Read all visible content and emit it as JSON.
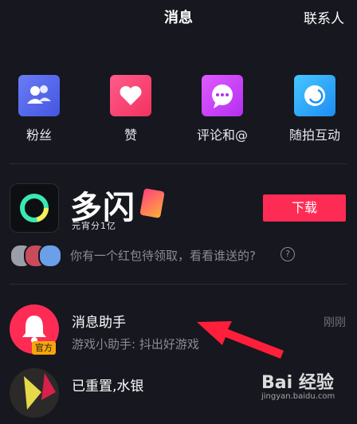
{
  "header": {
    "title": "消息",
    "contacts": "联系人"
  },
  "quick_actions": [
    {
      "label": "粉丝",
      "icon": "fans-icon"
    },
    {
      "label": "赞",
      "icon": "heart-icon"
    },
    {
      "label": "评论和@",
      "icon": "comment-icon"
    },
    {
      "label": "随拍互动",
      "icon": "interaction-icon"
    }
  ],
  "ad": {
    "brand": "多闪",
    "slogan": "元宵分1亿",
    "download_label": "下载",
    "footer_text": "你有一个红包待领取，看看谁送的?",
    "help_icon": "?"
  },
  "messages": [
    {
      "name": "消息助手",
      "subtitle": "游戏小助手: 抖出好游戏",
      "time": "刚刚",
      "badge": "官方"
    },
    {
      "name": "已重置,水银"
    }
  ],
  "watermark": {
    "text": "Bai 经验",
    "url": "jingyan.baidu.com"
  },
  "colors": {
    "accent": "#fe2c55",
    "background": "#16171f"
  }
}
